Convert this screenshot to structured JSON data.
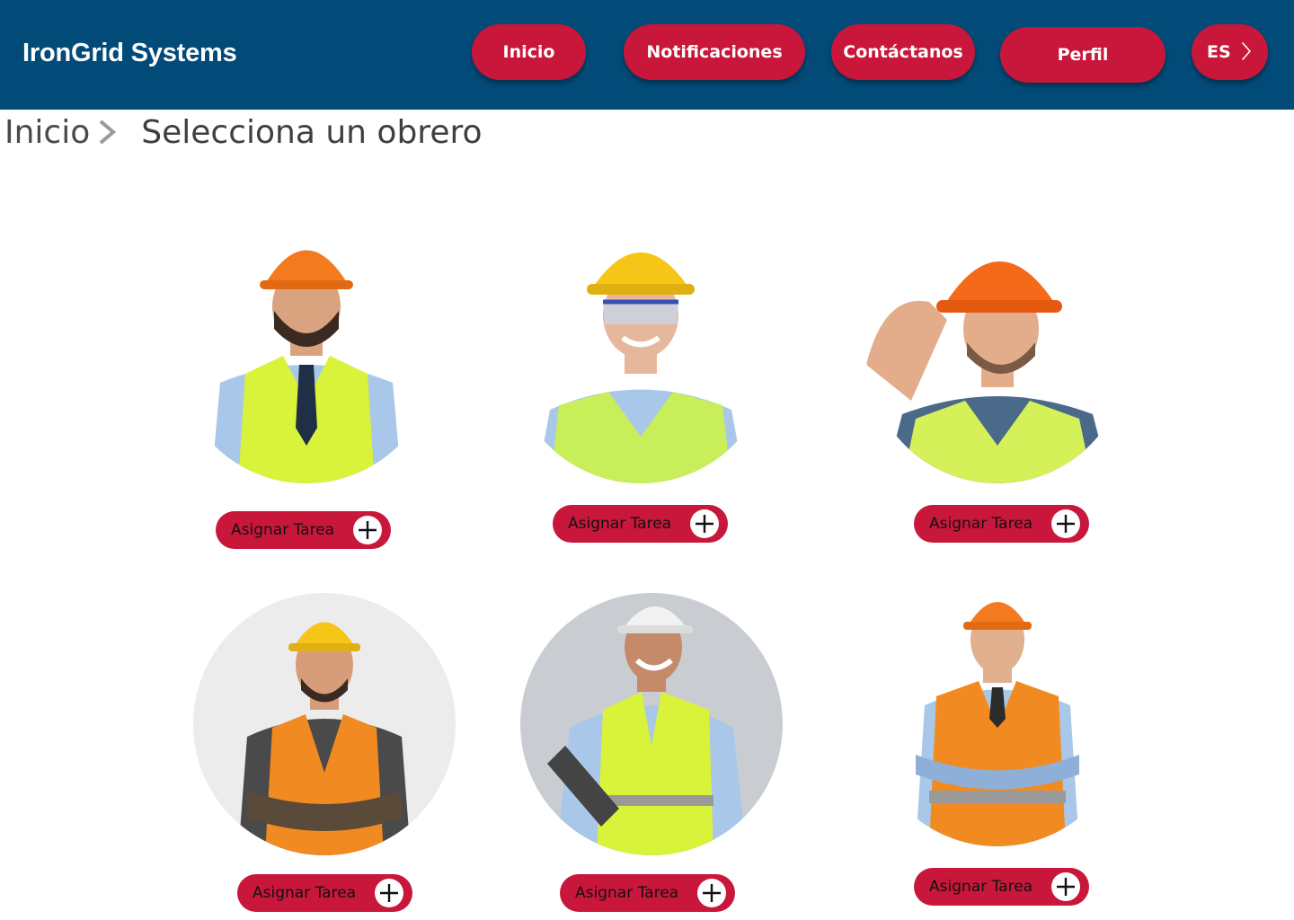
{
  "header": {
    "brand": "IronGrid Systems",
    "nav": [
      {
        "label": "Inicio"
      },
      {
        "label": "Notificaciones"
      },
      {
        "label": "Contáctanos"
      },
      {
        "label": "Perfil"
      }
    ],
    "language": {
      "label": "ES",
      "icon": "chevron-right-icon"
    }
  },
  "breadcrumb": {
    "home": "Inicio",
    "separator_icon": "chevron-right-icon",
    "current": "Selecciona un obrero"
  },
  "workers": [
    {
      "photo": "worker-photo",
      "helmet": "orange",
      "vest": "yellow-green",
      "button_label": "Asignar Tarea",
      "button_icon": "plus-circle-icon"
    },
    {
      "photo": "worker-photo",
      "helmet": "yellow",
      "vest": "yellow-green",
      "button_label": "Asignar Tarea",
      "button_icon": "plus-circle-icon"
    },
    {
      "photo": "worker-photo",
      "helmet": "orange",
      "vest": "yellow-green",
      "button_label": "Asignar Tarea",
      "button_icon": "plus-circle-icon"
    },
    {
      "photo": "worker-photo",
      "helmet": "yellow",
      "vest": "orange",
      "button_label": "Asignar Tarea",
      "button_icon": "plus-circle-icon"
    },
    {
      "photo": "worker-photo",
      "helmet": "white",
      "vest": "yellow-green",
      "button_label": "Asignar Tarea",
      "button_icon": "plus-circle-icon"
    },
    {
      "photo": "worker-photo",
      "helmet": "orange",
      "vest": "orange",
      "button_label": "Asignar Tarea",
      "button_icon": "plus-circle-icon"
    }
  ],
  "colors": {
    "header_bg": "#024b79",
    "accent": "#c8173a",
    "brand_text": "#ffffff",
    "helmet_orange": "#f47a1f",
    "helmet_yellow": "#f5c518",
    "helmet_white": "#f2f2f2",
    "vest_yellow_green": "#d9f23a",
    "vest_orange": "#f28a22"
  }
}
